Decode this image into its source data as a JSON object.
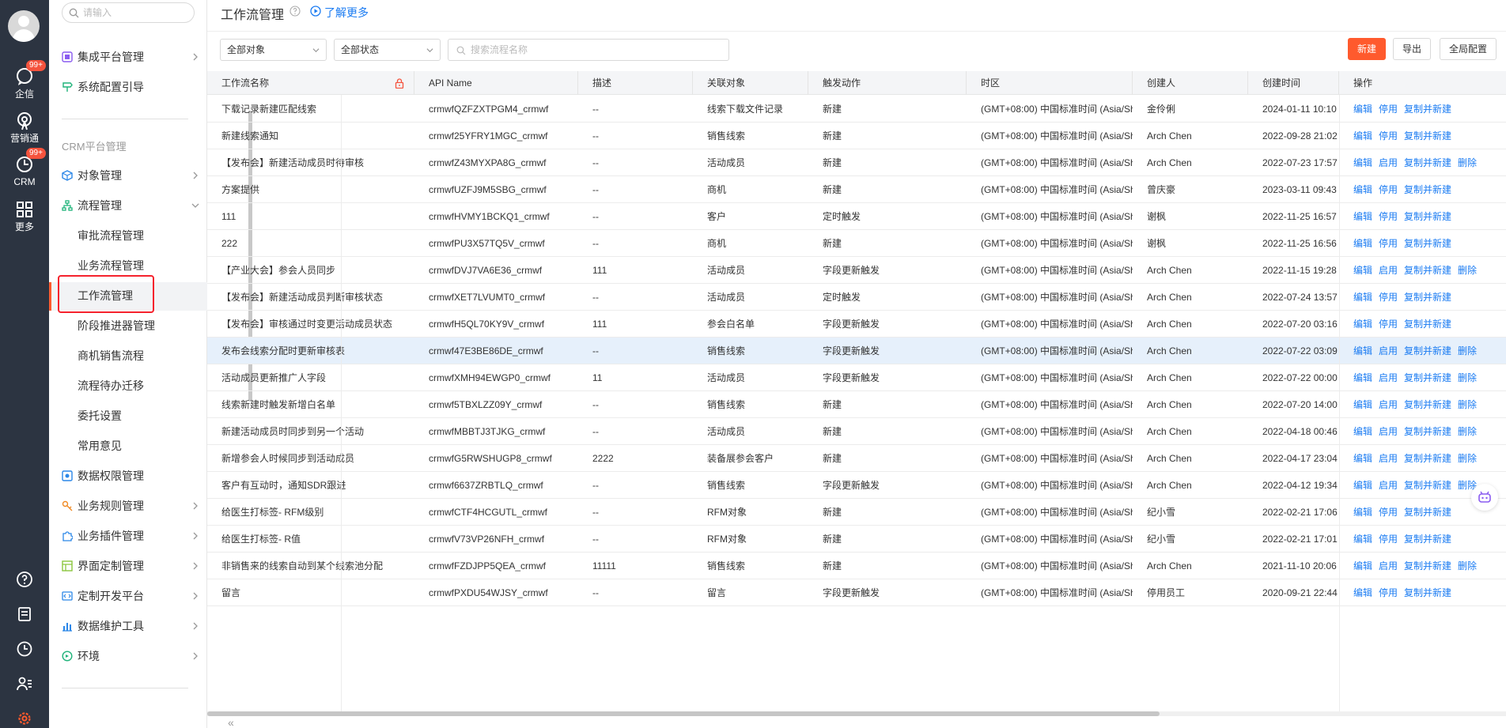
{
  "rail": {
    "items": [
      {
        "label": "企信",
        "badge": "99+"
      },
      {
        "label": "营销通"
      },
      {
        "label": "CRM",
        "badge": "99+"
      },
      {
        "label": "更多"
      }
    ]
  },
  "sidebar": {
    "search_placeholder": "请输入",
    "top_items": [
      {
        "label": "集成平台管理"
      },
      {
        "label": "系统配置引导"
      }
    ],
    "section_label": "CRM平台管理",
    "items": [
      {
        "label": "对象管理"
      },
      {
        "label": "流程管理"
      }
    ],
    "sub_items": [
      {
        "label": "审批流程管理"
      },
      {
        "label": "业务流程管理"
      },
      {
        "label": "工作流管理"
      },
      {
        "label": "阶段推进器管理"
      },
      {
        "label": "商机销售流程"
      },
      {
        "label": "流程待办迁移"
      },
      {
        "label": "委托设置"
      },
      {
        "label": "常用意见"
      }
    ],
    "bottom_items": [
      {
        "label": "数据权限管理"
      },
      {
        "label": "业务规则管理"
      },
      {
        "label": "业务插件管理"
      },
      {
        "label": "界面定制管理"
      },
      {
        "label": "定制开发平台"
      },
      {
        "label": "数据维护工具"
      },
      {
        "label": "环境"
      }
    ]
  },
  "header": {
    "title": "工作流管理",
    "learn_more": "了解更多"
  },
  "toolbar": {
    "object_filter": "全部对象",
    "status_filter": "全部状态",
    "search_placeholder": "搜索流程名称",
    "new_label": "新建",
    "export_label": "导出",
    "global_config_label": "全局配置"
  },
  "table": {
    "columns": [
      "工作流名称",
      "API Name",
      "描述",
      "关联对象",
      "触发动作",
      "时区",
      "创建人",
      "创建时间",
      "操作"
    ],
    "rows": [
      {
        "name": "下载记录新建匹配线索",
        "api": "crmwfQZFZXTPGM4_crmwf",
        "desc": "--",
        "object": "线索下载文件记录",
        "trigger": "新建",
        "tz": "(GMT+08:00) 中国标准时间 (Asia/Sh",
        "creator": "金伶俐",
        "created": "2024-01-11 10:10",
        "ops": [
          "编辑",
          "停用",
          "复制并新建"
        ]
      },
      {
        "name": "新建线索通知",
        "api": "crmwf25YFRY1MGC_crmwf",
        "desc": "--",
        "object": "销售线索",
        "trigger": "新建",
        "tz": "(GMT+08:00) 中国标准时间 (Asia/Sh",
        "creator": "Arch Chen",
        "created": "2022-09-28 21:02",
        "ops": [
          "编辑",
          "停用",
          "复制并新建"
        ]
      },
      {
        "name": "【发布会】新建活动成员时待审核",
        "api": "crmwfZ43MYXPA8G_crmwf",
        "desc": "--",
        "object": "活动成员",
        "trigger": "新建",
        "tz": "(GMT+08:00) 中国标准时间 (Asia/Sh",
        "creator": "Arch Chen",
        "created": "2022-07-23 17:57",
        "ops": [
          "编辑",
          "启用",
          "复制并新建",
          "删除"
        ]
      },
      {
        "name": "方案提供",
        "api": "crmwfUZFJ9M5SBG_crmwf",
        "desc": "--",
        "object": "商机",
        "trigger": "新建",
        "tz": "(GMT+08:00) 中国标准时间 (Asia/Sh",
        "creator": "曾庆豪",
        "created": "2023-03-11 09:43",
        "ops": [
          "编辑",
          "停用",
          "复制并新建"
        ]
      },
      {
        "name": "111",
        "api": "crmwfHVMY1BCKQ1_crmwf",
        "desc": "--",
        "object": "客户",
        "trigger": "定时触发",
        "tz": "(GMT+08:00) 中国标准时间 (Asia/Sh",
        "creator": "谢枫",
        "created": "2022-11-25 16:57",
        "ops": [
          "编辑",
          "停用",
          "复制并新建"
        ]
      },
      {
        "name": "222",
        "api": "crmwfPU3X57TQ5V_crmwf",
        "desc": "--",
        "object": "商机",
        "trigger": "新建",
        "tz": "(GMT+08:00) 中国标准时间 (Asia/Sh",
        "creator": "谢枫",
        "created": "2022-11-25 16:56",
        "ops": [
          "编辑",
          "停用",
          "复制并新建"
        ]
      },
      {
        "name": "【产业大会】参会人员同步",
        "api": "crmwfDVJ7VA6E36_crmwf",
        "desc": "111",
        "object": "活动成员",
        "trigger": "字段更新触发",
        "tz": "(GMT+08:00) 中国标准时间 (Asia/Sh",
        "creator": "Arch Chen",
        "created": "2022-11-15 19:28",
        "ops": [
          "编辑",
          "启用",
          "复制并新建",
          "删除"
        ]
      },
      {
        "name": "【发布会】新建活动成员判断审核状态",
        "api": "crmwfXET7LVUMT0_crmwf",
        "desc": "--",
        "object": "活动成员",
        "trigger": "定时触发",
        "tz": "(GMT+08:00) 中国标准时间 (Asia/Sh",
        "creator": "Arch Chen",
        "created": "2022-07-24 13:57",
        "ops": [
          "编辑",
          "停用",
          "复制并新建"
        ]
      },
      {
        "name": "【发布会】审核通过时变更活动成员状态",
        "api": "crmwfH5QL70KY9V_crmwf",
        "desc": "111",
        "object": "参会白名单",
        "trigger": "字段更新触发",
        "tz": "(GMT+08:00) 中国标准时间 (Asia/Sh",
        "creator": "Arch Chen",
        "created": "2022-07-20 03:16",
        "ops": [
          "编辑",
          "停用",
          "复制并新建"
        ]
      },
      {
        "name": "发布会线索分配时更新审核表",
        "api": "crmwf47E3BE86DE_crmwf",
        "desc": "--",
        "object": "销售线索",
        "trigger": "字段更新触发",
        "tz": "(GMT+08:00) 中国标准时间 (Asia/Sh",
        "creator": "Arch Chen",
        "created": "2022-07-22 03:09",
        "ops": [
          "编辑",
          "启用",
          "复制并新建",
          "删除"
        ]
      },
      {
        "name": "活动成员更新推广人字段",
        "api": "crmwfXMH94EWGP0_crmwf",
        "desc": "11",
        "object": "活动成员",
        "trigger": "字段更新触发",
        "tz": "(GMT+08:00) 中国标准时间 (Asia/Sh",
        "creator": "Arch Chen",
        "created": "2022-07-22 00:00",
        "ops": [
          "编辑",
          "启用",
          "复制并新建",
          "删除"
        ]
      },
      {
        "name": "线索新建时触发新增白名单",
        "api": "crmwf5TBXLZZ09Y_crmwf",
        "desc": "--",
        "object": "销售线索",
        "trigger": "新建",
        "tz": "(GMT+08:00) 中国标准时间 (Asia/Sh",
        "creator": "Arch Chen",
        "created": "2022-07-20 14:00",
        "ops": [
          "编辑",
          "启用",
          "复制并新建",
          "删除"
        ]
      },
      {
        "name": "新建活动成员时同步到另一个活动",
        "api": "crmwfMBBTJ3TJKG_crmwf",
        "desc": "--",
        "object": "活动成员",
        "trigger": "新建",
        "tz": "(GMT+08:00) 中国标准时间 (Asia/Sh",
        "creator": "Arch Chen",
        "created": "2022-04-18 00:46",
        "ops": [
          "编辑",
          "启用",
          "复制并新建",
          "删除"
        ]
      },
      {
        "name": "新增参会人时候同步到活动成员",
        "api": "crmwfG5RWSHUGP8_crmwf",
        "desc": "2222",
        "object": "装备展参会客户",
        "trigger": "新建",
        "tz": "(GMT+08:00) 中国标准时间 (Asia/Sh",
        "creator": "Arch Chen",
        "created": "2022-04-17 23:04",
        "ops": [
          "编辑",
          "启用",
          "复制并新建",
          "删除"
        ]
      },
      {
        "name": "客户有互动时，通知SDR跟进",
        "api": "crmwf6637ZRBTLQ_crmwf",
        "desc": "--",
        "object": "销售线索",
        "trigger": "字段更新触发",
        "tz": "(GMT+08:00) 中国标准时间 (Asia/Sh",
        "creator": "Arch Chen",
        "created": "2022-04-12 19:34",
        "ops": [
          "编辑",
          "启用",
          "复制并新建",
          "删除"
        ]
      },
      {
        "name": "给医生打标签- RFM级别",
        "api": "crmwfCTF4HCGUTL_crmwf",
        "desc": "--",
        "object": "RFM对象",
        "trigger": "新建",
        "tz": "(GMT+08:00) 中国标准时间 (Asia/Sh",
        "creator": "纪小雪",
        "created": "2022-02-21 17:06",
        "ops": [
          "编辑",
          "停用",
          "复制并新建"
        ]
      },
      {
        "name": "给医生打标签- R值",
        "api": "crmwfV73VP26NFH_crmwf",
        "desc": "--",
        "object": "RFM对象",
        "trigger": "新建",
        "tz": "(GMT+08:00) 中国标准时间 (Asia/Sh",
        "creator": "纪小雪",
        "created": "2022-02-21 17:01",
        "ops": [
          "编辑",
          "停用",
          "复制并新建"
        ]
      },
      {
        "name": "非销售来的线索自动到某个线索池分配",
        "api": "crmwfFZDJPP5QEA_crmwf",
        "desc": "11111",
        "object": "销售线索",
        "trigger": "新建",
        "tz": "(GMT+08:00) 中国标准时间 (Asia/Sh",
        "creator": "Arch Chen",
        "created": "2021-11-10 20:06",
        "ops": [
          "编辑",
          "启用",
          "复制并新建",
          "删除"
        ]
      },
      {
        "name": "留言",
        "api": "crmwfPXDU54WJSY_crmwf",
        "desc": "--",
        "object": "留言",
        "trigger": "字段更新触发",
        "tz": "(GMT+08:00) 中国标准时间 (Asia/Sh",
        "creator": "停用员工",
        "created": "2020-09-21 22:44",
        "ops": [
          "编辑",
          "停用",
          "复制并新建"
        ]
      }
    ],
    "highlighted_row": 9
  },
  "colors": {
    "accent": "#ff5a2d",
    "link": "#1a7bf2",
    "rail_bg": "#2c3441",
    "badge": "#f5533d"
  }
}
